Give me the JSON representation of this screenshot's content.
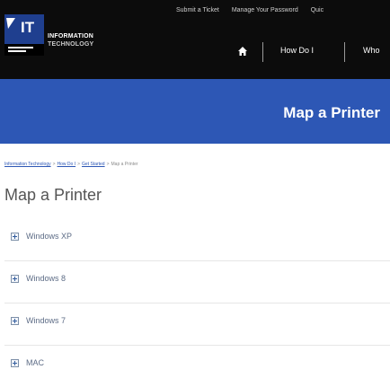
{
  "header": {
    "logo_badge": "IT",
    "logo_lines": [
      "INFORMATION",
      "TECHNOLOGY"
    ],
    "utility_links": [
      "Submit a Ticket",
      "Manage Your Password",
      "Quic"
    ],
    "nav": {
      "home_icon": "home-icon",
      "items": [
        "How Do I",
        "Who"
      ]
    }
  },
  "banner": {
    "title": "Map a Printer"
  },
  "breadcrumb": {
    "links": [
      "Information Technology",
      "How Do I",
      "Get Started"
    ],
    "separator": ">",
    "current": "Map a Printer"
  },
  "page_title": "Map a Printer",
  "os_items": [
    {
      "icon": "expand-plus-icon",
      "label": "Windows XP"
    },
    {
      "icon": "expand-plus-icon",
      "label": "Windows 8"
    },
    {
      "icon": "expand-plus-icon",
      "label": "Windows 7"
    },
    {
      "icon": "expand-plus-icon",
      "label": "MAC"
    }
  ],
  "colors": {
    "header_bg": "#0c0c0c",
    "banner_bg": "#2d57b5",
    "link": "#2d57b5",
    "text_muted": "#5d6c86"
  }
}
